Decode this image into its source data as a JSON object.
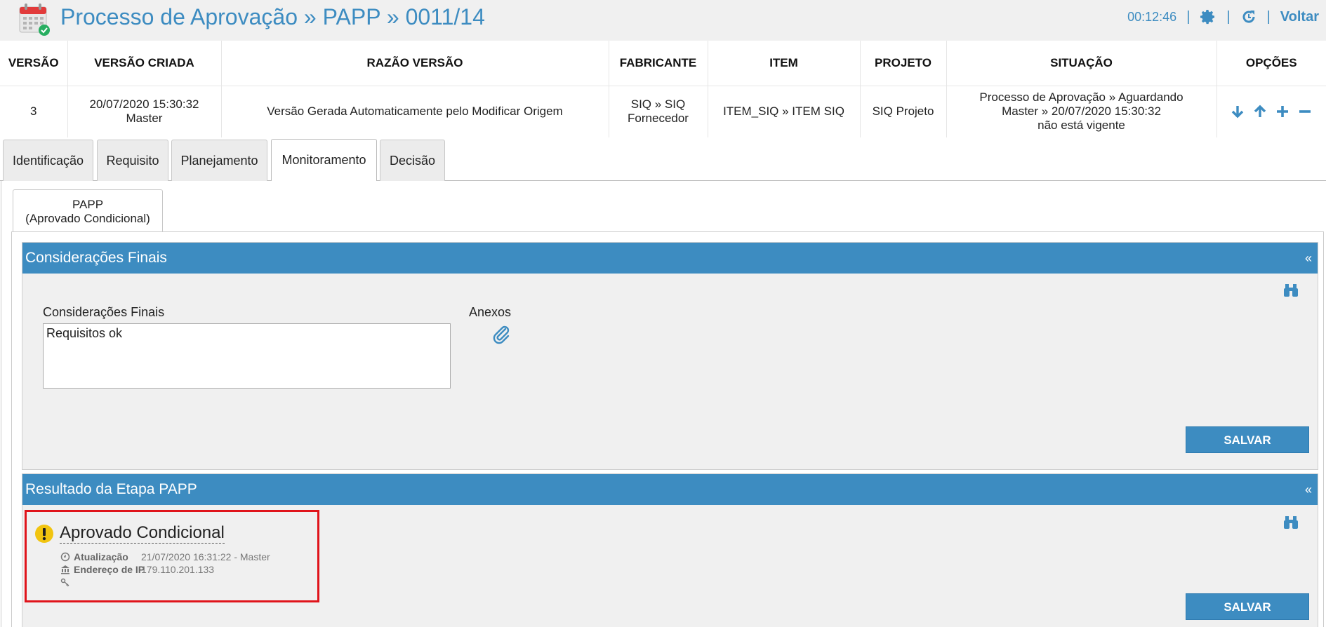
{
  "header": {
    "title": "Processo de Aprovação » PAPP » 0011/14",
    "timer": "00:12:46",
    "separator": "|",
    "back_label": "Voltar",
    "brand_color": "#3d8cc1"
  },
  "version_table": {
    "columns": [
      "VERSÃO",
      "VERSÃO CRIADA",
      "RAZÃO VERSÃO",
      "FABRICANTE",
      "ITEM",
      "PROJETO",
      "SITUAÇÃO",
      "OPÇÕES"
    ],
    "row": {
      "versao": "3",
      "criada_line1": "20/07/2020 15:30:32",
      "criada_line2": "Master",
      "razao": "Versão Gerada Automaticamente pelo Modificar Origem",
      "fabricante_line1": "SIQ » SIQ",
      "fabricante_line2": "Fornecedor",
      "item": "ITEM_SIQ » ITEM SIQ",
      "projeto": "SIQ Projeto",
      "situacao_line1": "Processo de Aprovação » Aguardando",
      "situacao_line2": "Master » 20/07/2020 15:30:32",
      "situacao_line3": "não está vigente"
    },
    "option_icons": [
      "arrow-down-icon",
      "arrow-up-icon",
      "plus-icon",
      "minus-icon"
    ]
  },
  "tabs": [
    "Identificação",
    "Requisito",
    "Planejamento",
    "Monitoramento",
    "Decisão"
  ],
  "active_tab": "Monitoramento",
  "subtab": {
    "line1": "PAPP",
    "line2": "(Aprovado Condicional)"
  },
  "consideracoes": {
    "bar_title": "Considerações Finais",
    "collapse": "«",
    "field_label": "Considerações Finais",
    "field_value": "Requisitos ok",
    "attachments_label": "Anexos",
    "save_label": "SALVAR"
  },
  "resultado": {
    "bar_title": "Resultado da Etapa PAPP",
    "collapse": "«",
    "status": "Aprovado Condicional",
    "update_key": "Atualização",
    "update_value": "21/07/2020 16:31:22 - Master",
    "ip_key": "Endereço de IP",
    "ip_value": "179.110.201.133",
    "save_label": "SALVAR",
    "highlight_color": "#e0141b",
    "warning_color": "#f1c40f"
  }
}
